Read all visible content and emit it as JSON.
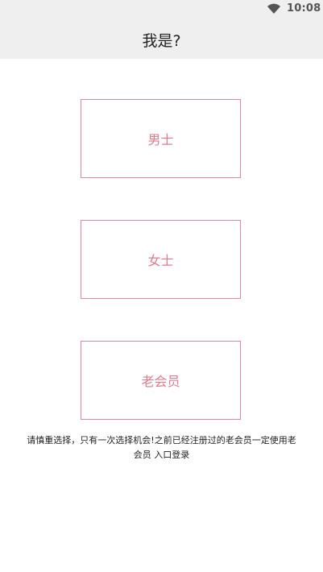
{
  "status_bar": {
    "time": "10:08",
    "icon": "wifi-icon"
  },
  "header": {
    "title": "我是?"
  },
  "choices": {
    "male_label": "男士",
    "female_label": "女士",
    "old_member_label": "老会员"
  },
  "notice": {
    "line1": "请慎重选择，只有一次选择机会!之前已经注册过的老会员一定使用老",
    "line2": "会员 入口登录"
  },
  "colors": {
    "accent": "#dc7b8f",
    "border": "#d98a9c",
    "header_bg": "#efefef"
  }
}
